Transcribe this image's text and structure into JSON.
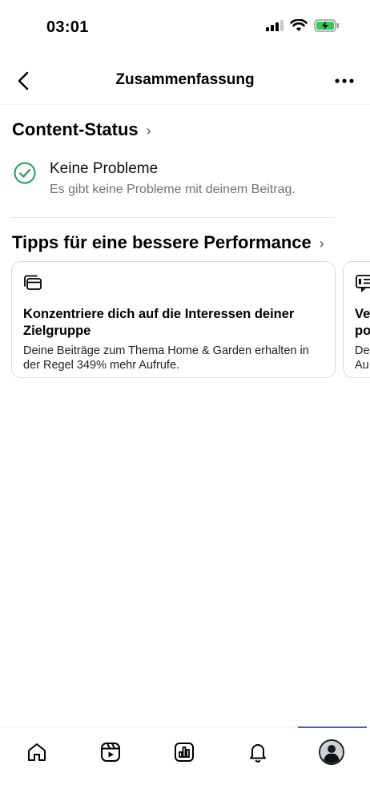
{
  "status_bar": {
    "time": "03:01"
  },
  "header": {
    "title": "Zusammenfassung"
  },
  "content_status": {
    "title": "Content-Status",
    "item_title": "Keine Probleme",
    "item_subtitle": "Es gibt keine Probleme mit deinem Beitrag."
  },
  "tips": {
    "title": "Tipps für eine bessere Performance",
    "cards": [
      {
        "icon": "cards-stack-icon",
        "title": "Konzentriere dich auf die Interessen deiner Zielgruppe",
        "description": "Deine Beiträge zum Thema Home & Garden erhalten in der Regel 349% mehr Aufrufe."
      },
      {
        "icon": "list-icon",
        "title": "Ve\npo",
        "description": "De\nAu"
      }
    ]
  },
  "colors": {
    "check": "#1f9d55",
    "accent_line": "#3b5bdb",
    "battery": "#34c759"
  },
  "tabbar": {
    "items": [
      "home-icon",
      "reels-icon",
      "insights-icon",
      "notifications-icon",
      "profile-avatar"
    ],
    "active": "profile-avatar"
  }
}
